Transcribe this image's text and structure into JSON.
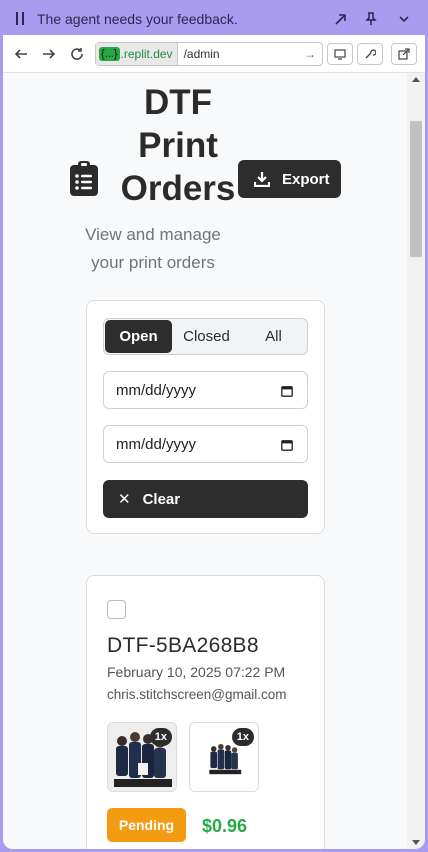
{
  "agent_bar": {
    "message": "The agent needs your feedback."
  },
  "browser": {
    "url_host_badge": "{...}",
    "url_host": ".replit.dev",
    "url_path": "/admin"
  },
  "header": {
    "title": "DTF Print Orders",
    "export_label": "Export",
    "subtitle": "View and manage your print orders"
  },
  "filters": {
    "tabs": [
      {
        "label": "Open",
        "active": true
      },
      {
        "label": "Closed",
        "active": false
      },
      {
        "label": "All",
        "active": false
      }
    ],
    "start_date_placeholder": "mm/dd/yyyy",
    "end_date_placeholder": "mm/dd/yyyy",
    "clear_label": "Clear"
  },
  "orders": [
    {
      "id": "DTF-5BA268B8",
      "date": "February 10, 2025 07:22 PM",
      "email": "chris.stitchscreen@gmail.com",
      "items": [
        {
          "quantity": "1x",
          "image": "group-photo"
        },
        {
          "quantity": "1x",
          "image": "group-photo-small"
        }
      ],
      "status": "Pending",
      "total": "$0.96"
    }
  ],
  "colors": {
    "agent_bar": "#a99cf0",
    "primary_dark": "#2d2d2d",
    "pending": "#f39c12",
    "price": "#28a745",
    "host_badge": "#28a745"
  }
}
